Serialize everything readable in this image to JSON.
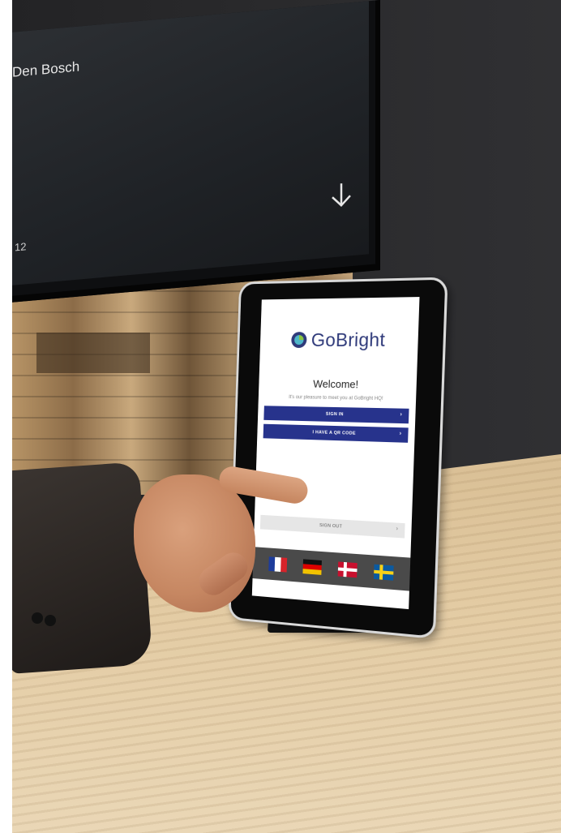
{
  "tv": {
    "title": "Den Bosch",
    "number": "12",
    "arrow_icon": "arrow-down-icon"
  },
  "kiosk": {
    "brand": "GoBright",
    "logo_icon": "gobright-logo-icon",
    "welcome": "Welcome!",
    "subtitle": "It's our pleasure to meet you at GoBright HQ!",
    "buttons": {
      "sign_in": "SIGN IN",
      "qr_code": "I HAVE A QR CODE",
      "sign_out": "SIGN OUT",
      "chevron": "›"
    },
    "flags": [
      "flag-fr-icon",
      "flag-de-icon",
      "flag-dk-icon",
      "flag-se-icon"
    ],
    "colors": {
      "brand_blue": "#27338c",
      "flag_bar": "#4a4a4a",
      "sign_out_bg": "#e6e6e6"
    }
  },
  "frame": {
    "accent_bar_color": "#1a3df0"
  }
}
